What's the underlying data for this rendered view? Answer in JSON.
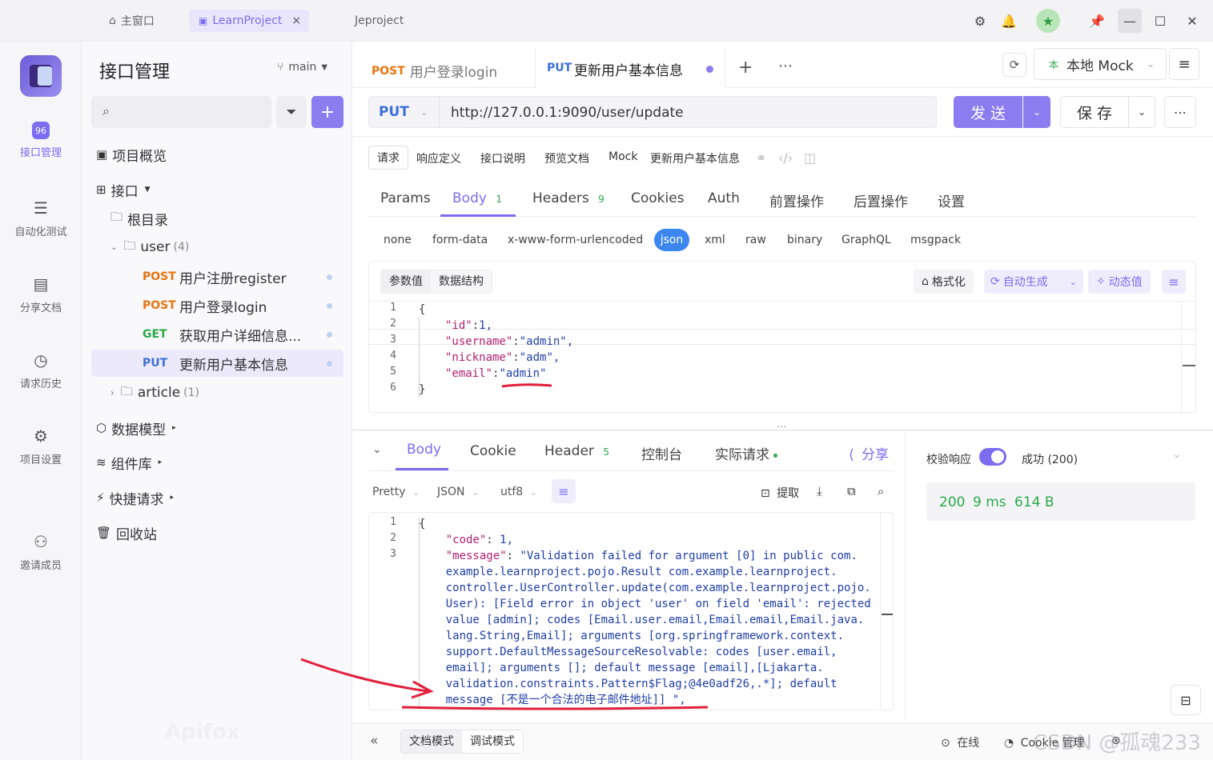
{
  "titlebar": {
    "home_tab": "主窗口",
    "project_tab": "LearnProject",
    "close_x": "×",
    "other_tab": "Jeproject"
  },
  "leftnav": [
    {
      "label": "接口管理"
    },
    {
      "label": "自动化测试"
    },
    {
      "label": "分享文档"
    },
    {
      "label": "请求历史"
    },
    {
      "label": "项目设置"
    },
    {
      "label": "邀请成员"
    }
  ],
  "tree": {
    "title": "接口管理",
    "branch": "main",
    "overview": "项目概览",
    "interfaces": "接口",
    "root": "根目录",
    "user_folder": "user",
    "user_count": "(4)",
    "endpoints": [
      {
        "method": "POST",
        "name": "用户注册register"
      },
      {
        "method": "POST",
        "name": "用户登录login"
      },
      {
        "method": "GET",
        "name": "获取用户详细信息..."
      },
      {
        "method": "PUT",
        "name": "更新用户基本信息"
      }
    ],
    "article_folder": "article",
    "article_count": "(1)",
    "models": "数据模型",
    "components": "组件库",
    "quick": "快捷请求",
    "trash": "回收站",
    "watermark": "Apifox"
  },
  "tabs": {
    "tab1_method": "POST",
    "tab1_name": "用户登录login",
    "tab2_method": "PUT",
    "tab2_name": "更新用户基本信息",
    "env": "本地 Mock",
    "env_badge": "本"
  },
  "request": {
    "method": "PUT",
    "url": "http://127.0.0.1:9090/user/update",
    "send": "发 送",
    "save": "保 存"
  },
  "subtabs": [
    "请求",
    "响应定义",
    "接口说明",
    "预览文档",
    "Mock",
    "更新用户基本信息"
  ],
  "param_tabs": [
    {
      "label": "Params"
    },
    {
      "label": "Body",
      "badge": "1"
    },
    {
      "label": "Headers",
      "badge": "9"
    },
    {
      "label": "Cookies"
    },
    {
      "label": "Auth"
    },
    {
      "label": "前置操作"
    },
    {
      "label": "后置操作"
    },
    {
      "label": "设置"
    }
  ],
  "body_types": [
    "none",
    "form-data",
    "x-www-form-urlencoded",
    "json",
    "xml",
    "raw",
    "binary",
    "GraphQL",
    "msgpack"
  ],
  "editor": {
    "tab_values": "参数值",
    "tab_schema": "数据结构",
    "format": "格式化",
    "auto_gen": "自动生成",
    "dynamic": "动态值",
    "lines": [
      {
        "n": "1",
        "text": "{"
      },
      {
        "n": "2",
        "key": "\"id\"",
        "sep": ":",
        "val": "1,"
      },
      {
        "n": "3",
        "key": "\"username\"",
        "sep": ":",
        "val": "\"admin\","
      },
      {
        "n": "4",
        "key": "\"nickname\"",
        "sep": ":",
        "val": "\"adm\","
      },
      {
        "n": "5",
        "key": "\"email\"",
        "sep": ":",
        "val": "\"admin\""
      },
      {
        "n": "6",
        "text": "}"
      }
    ]
  },
  "response": {
    "tabs": [
      {
        "label": "Body"
      },
      {
        "label": "Cookie"
      },
      {
        "label": "Header",
        "badge": "5"
      },
      {
        "label": "控制台"
      },
      {
        "label": "实际请求"
      }
    ],
    "share": "分享",
    "pretty": "Pretty",
    "json": "JSON",
    "utf8": "utf8",
    "extract": "提取",
    "lines": [
      {
        "n": "1",
        "text": "{"
      },
      {
        "n": "2",
        "text": "    \"code\": 1,"
      },
      {
        "n": "3",
        "text": "    \"message\": \"Validation failed for argument [0] in public com."
      },
      {
        "n": "",
        "text": "    example.learnproject.pojo.Result com.example.learnproject."
      },
      {
        "n": "",
        "text": "    controller.UserController.update(com.example.learnproject.pojo."
      },
      {
        "n": "",
        "text": "    User): [Field error in object 'user' on field 'email': rejected"
      },
      {
        "n": "",
        "text": "    value [admin]; codes [Email.user.email,Email.email,Email.java."
      },
      {
        "n": "",
        "text": "    lang.String,Email]; arguments [org.springframework.context."
      },
      {
        "n": "",
        "text": "    support.DefaultMessageSourceResolvable: codes [user.email,"
      },
      {
        "n": "",
        "text": "    email]; arguments []; default message [email],[Ljakarta."
      },
      {
        "n": "",
        "text": "    validation.constraints.Pattern$Flag;@4e0adf26,.*]; default"
      },
      {
        "n": "",
        "text": "    message [不是一个合法的电子邮件地址]] \","
      }
    ],
    "validate": "校验响应",
    "status": "成功 (200)",
    "code": "200",
    "time": "9 ms",
    "size": "614 B"
  },
  "footer": {
    "doc_mode": "文档模式",
    "debug_mode": "调试模式",
    "online": "在线",
    "cookie": "Cookie 管理",
    "watermark": "CSDN @孤魂233"
  }
}
